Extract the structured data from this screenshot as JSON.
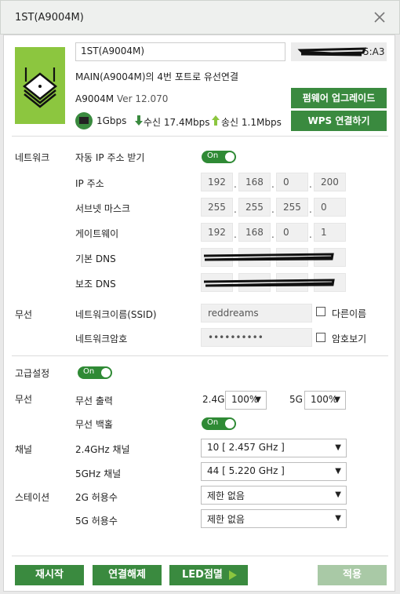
{
  "window": {
    "title": "1ST(A9004M)"
  },
  "device": {
    "name_value": "1ST(A9004M)",
    "mac_suffix": "5:A3",
    "connection": "MAIN(A9004M)의 4번 포트로 유선연결",
    "model": "A9004M",
    "version": "Ver 12.070",
    "link_speed": "1Gbps",
    "rx": "수신 17.4Mbps",
    "tx": "송신 1.1Mbps",
    "firmware_button": "펌웨어 업그레이드",
    "wps_button": "WPS 연결하기"
  },
  "network": {
    "section": "네트워크",
    "auto_ip_label": "자동 IP 주소 받기",
    "auto_ip_toggle": "On",
    "ip_label": "IP 주소",
    "ip": [
      "192",
      "168",
      "0",
      "200"
    ],
    "subnet_label": "서브넷 마스크",
    "subnet": [
      "255",
      "255",
      "255",
      "0"
    ],
    "gateway_label": "게이트웨이",
    "gateway": [
      "192",
      "168",
      "0",
      "1"
    ],
    "dns1_label": "기본 DNS",
    "dns2_label": "보조 DNS"
  },
  "wireless": {
    "section": "무선",
    "ssid_label": "네트워크이름(SSID)",
    "ssid_value": "reddreams",
    "other_name_label": "다른이름",
    "password_label": "네트워크암호",
    "password_value": "••••••••••",
    "show_password_label": "암호보기"
  },
  "advanced": {
    "section": "고급설정",
    "toggle": "On",
    "wireless_section": "무선",
    "output_label": "무선 출력",
    "band_24": "2.4G",
    "output_24": "100%",
    "band_5": "5G",
    "output_5": "100%",
    "backhaul_label": "무선 백홀",
    "backhaul_toggle": "On",
    "channel_section": "채널",
    "ch24_label": "2.4GHz 채널",
    "ch24_value": "10 [ 2.457 GHz ]",
    "ch5_label": "5GHz 채널",
    "ch5_value": "44 [ 5.220 GHz ]",
    "station_section": "스테이션",
    "allow2g_label": "2G 허용수",
    "allow2g_value": "제한 없음",
    "allow5g_label": "5G 허용수",
    "allow5g_value": "제한 없음"
  },
  "footer": {
    "restart": "재시작",
    "disconnect": "연결해제",
    "led": "LED점멸",
    "apply": "적용"
  },
  "colors": {
    "accent": "#3a8a3f",
    "device_icon_bg": "#8cc63f",
    "apply_disabled": "#a9c9a6"
  }
}
